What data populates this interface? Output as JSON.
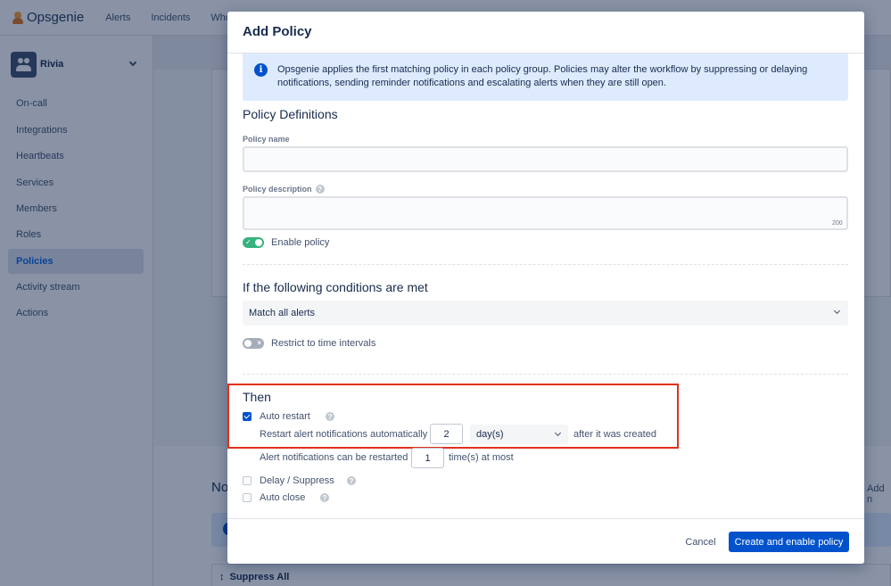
{
  "app": {
    "logo_text": "Opsgenie",
    "nav": [
      "Alerts",
      "Incidents",
      "Who is"
    ]
  },
  "sidebar": {
    "team_name": "Rivia",
    "items": [
      {
        "label": "On-call",
        "active": false
      },
      {
        "label": "Integrations",
        "active": false
      },
      {
        "label": "Heartbeats",
        "active": false
      },
      {
        "label": "Services",
        "active": false
      },
      {
        "label": "Members",
        "active": false
      },
      {
        "label": "Roles",
        "active": false
      },
      {
        "label": "Policies",
        "active": true
      },
      {
        "label": "Activity stream",
        "active": false
      },
      {
        "label": "Actions",
        "active": false
      }
    ]
  },
  "background": {
    "no_heading": "No",
    "add_link": "Add n",
    "suppress_all": "Suppress All",
    "suppress_arrow": "↕"
  },
  "modal": {
    "title": "Add Policy",
    "info_text": "Opsgenie applies the first matching policy in each policy group. Policies may alter the workflow by suppressing or delaying notifications, sending reminder notifications and escalating alerts when they are still open.",
    "definitions": {
      "heading": "Policy Definitions",
      "name_label": "Policy name",
      "name_value": "",
      "description_label": "Policy description",
      "description_value": "",
      "char_count": "200",
      "enable_label": "Enable policy",
      "enable_on": true
    },
    "conditions": {
      "heading": "If the following conditions are met",
      "match_selected": "Match all alerts",
      "restrict_label": "Restrict to time intervals",
      "restrict_on": false
    },
    "then": {
      "heading": "Then",
      "auto_restart_label": "Auto restart",
      "auto_restart_checked": true,
      "restart_prefix": "Restart alert notifications automatically",
      "restart_value": "2",
      "restart_unit": "day(s)",
      "restart_suffix": "after it was created",
      "max_prefix": "Alert notifications can be restarted",
      "max_value": "1",
      "max_suffix": "time(s) at most",
      "delay_label": "Delay / Suppress",
      "delay_checked": false,
      "auto_close_label": "Auto close",
      "auto_close_checked": false
    },
    "footer": {
      "cancel_label": "Cancel",
      "primary_label": "Create and enable policy"
    }
  },
  "colors": {
    "accent": "#0052CC",
    "toggle_on": "#36B37E",
    "highlight_box": "#E0301E",
    "info_bg": "#DEEBFF"
  },
  "icons": {
    "info": "info-icon",
    "help": "question-circle-icon",
    "chevron": "chevron-down-icon",
    "check": "check-icon",
    "cross": "x-icon",
    "logo": "opsgenie-logo-icon",
    "team": "people-icon"
  }
}
